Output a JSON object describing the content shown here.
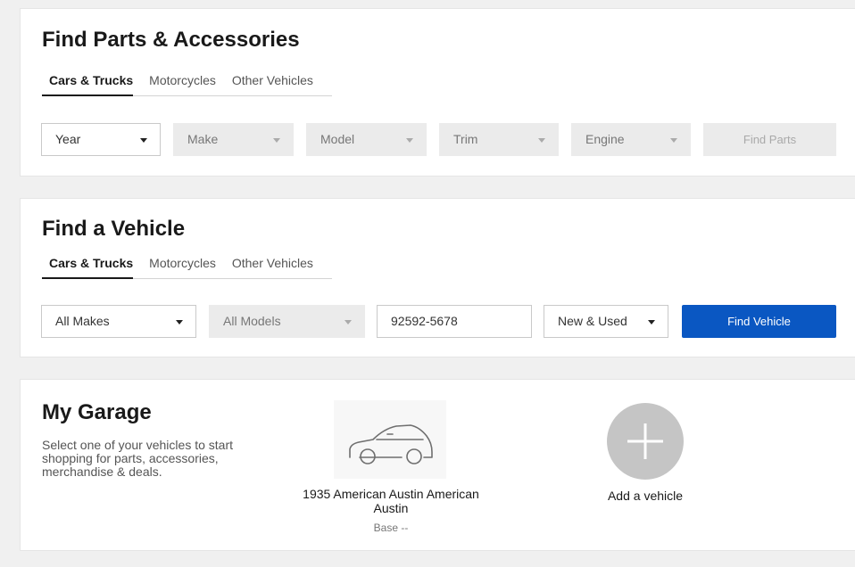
{
  "parts": {
    "title": "Find Parts & Accessories",
    "tabs": [
      "Cars & Trucks",
      "Motorcycles",
      "Other Vehicles"
    ],
    "year": "Year",
    "make": "Make",
    "model": "Model",
    "trim": "Trim",
    "engine": "Engine",
    "button": "Find Parts"
  },
  "vehicle": {
    "title": "Find a Vehicle",
    "tabs": [
      "Cars & Trucks",
      "Motorcycles",
      "Other Vehicles"
    ],
    "makes": "All Makes",
    "models": "All Models",
    "zip": "92592-5678",
    "condition": "New & Used",
    "button": "Find Vehicle"
  },
  "garage": {
    "title": "My Garage",
    "description": "Select one of your vehicles to start shopping for parts, accessories, merchandise & deals.",
    "car_icon": "car-outline-icon",
    "car_name": "1935 American Austin American Austin",
    "car_trim": "Base --",
    "add_icon": "plus-icon",
    "add_label": "Add a vehicle"
  },
  "colors": {
    "primary": "#0a57c2",
    "disabled_bg": "#ebebeb",
    "text": "#191919"
  }
}
